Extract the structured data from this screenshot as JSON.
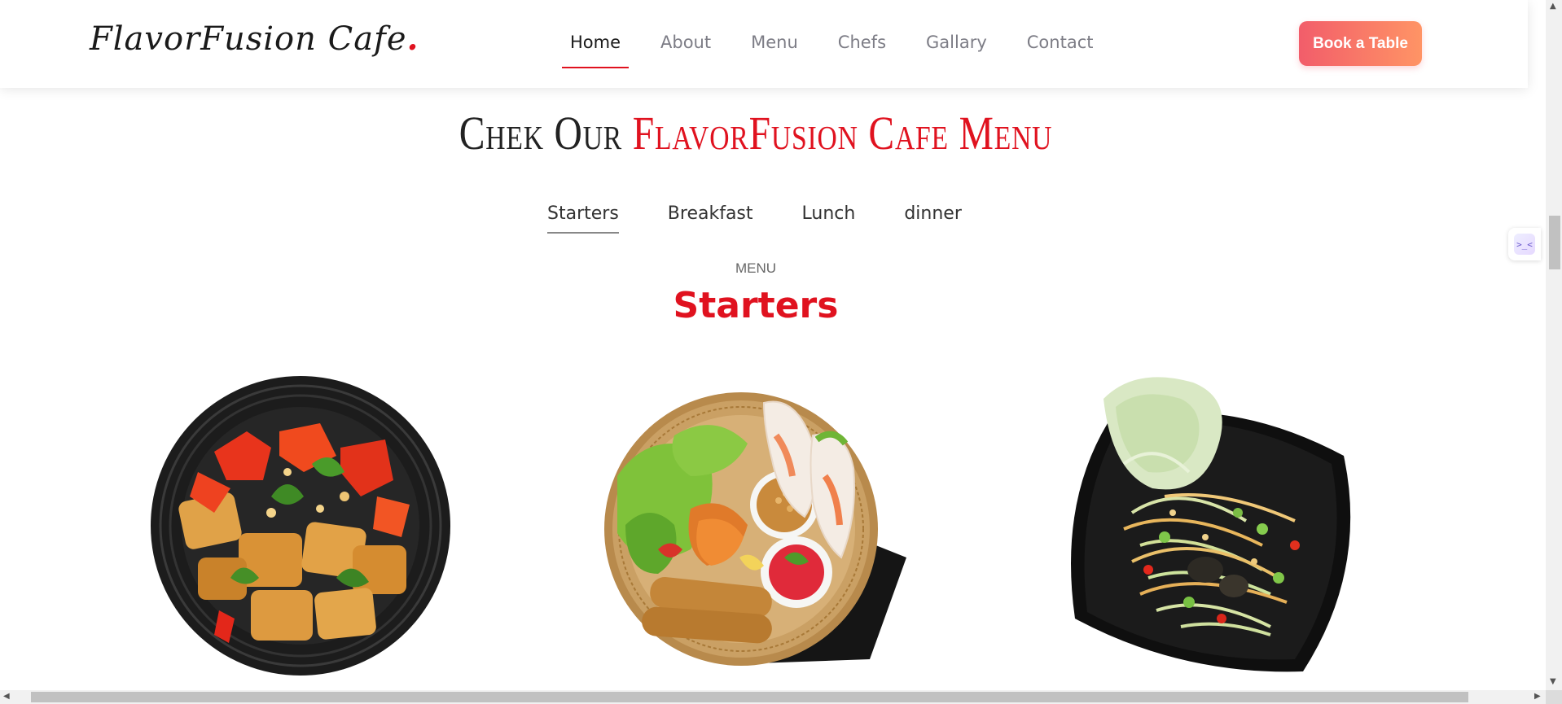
{
  "header": {
    "logo_text": "FlavorFusion Cafe",
    "logo_dot": ".",
    "nav": [
      {
        "label": "Home",
        "active": true
      },
      {
        "label": "About",
        "active": false
      },
      {
        "label": "Menu",
        "active": false
      },
      {
        "label": "Chefs",
        "active": false
      },
      {
        "label": "Gallary",
        "active": false
      },
      {
        "label": "Contact",
        "active": false
      }
    ],
    "book_button": "Book a Table"
  },
  "section": {
    "heading_dark": "Chek Our",
    "heading_red": "FlavorFusion Cafe Menu"
  },
  "tabs": [
    {
      "label": "Starters",
      "active": true
    },
    {
      "label": "Breakfast",
      "active": false
    },
    {
      "label": "Lunch",
      "active": false
    },
    {
      "label": "dinner",
      "active": false
    }
  ],
  "menu": {
    "eyebrow": "MENU",
    "title": "Starters"
  },
  "dishes": [
    {
      "name": "dish-1"
    },
    {
      "name": "dish-2"
    },
    {
      "name": "dish-3"
    }
  ],
  "side_widget": {
    "glyph": ">_<"
  },
  "scrollbar_arrows": {
    "up": "▲",
    "down": "▼",
    "left": "◀",
    "right": "▶"
  },
  "colors": {
    "accent": "#e0121f",
    "button_start": "#f25d6a",
    "button_end": "#ff9465",
    "nav_inactive": "#7d7d86"
  }
}
